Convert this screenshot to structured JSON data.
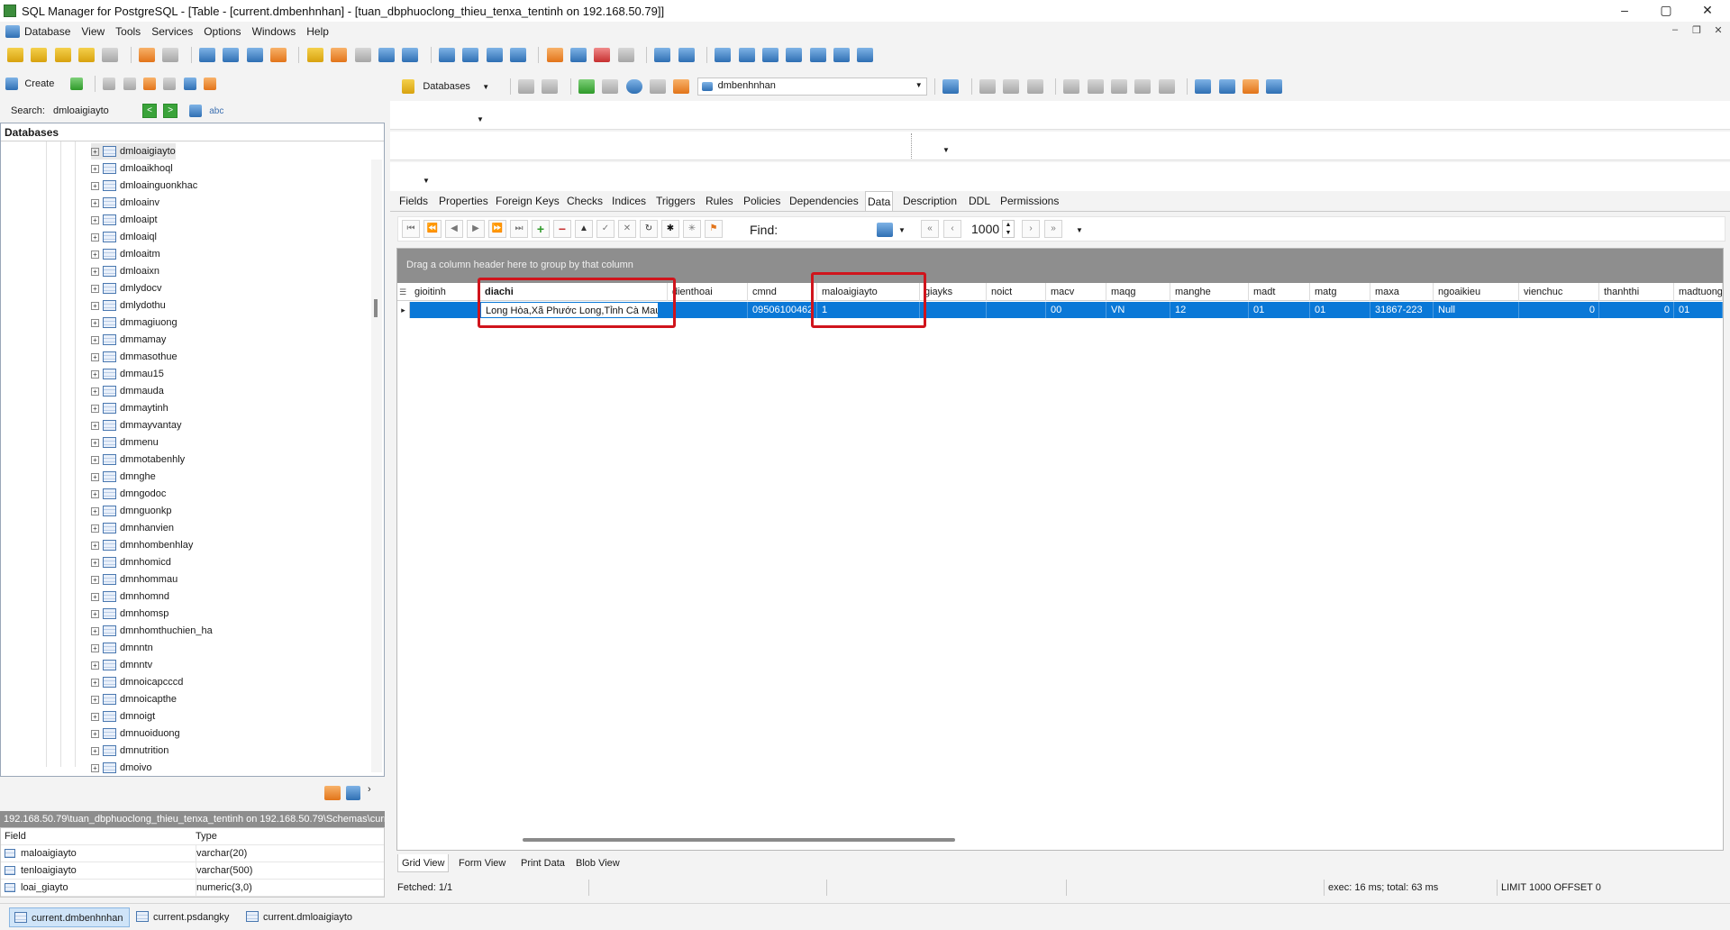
{
  "window": {
    "title": "SQL Manager for PostgreSQL - [Table - [current.dmbenhnhan] - [tuan_dbphuoclong_thieu_tenxa_tentinh on 192.168.50.79]]",
    "min": "–",
    "max": "▢",
    "close": "✕"
  },
  "menu": [
    "Database",
    "View",
    "Tools",
    "Services",
    "Options",
    "Windows",
    "Help"
  ],
  "left_toolbar": {
    "create_label": "Create"
  },
  "search": {
    "label": "Search:",
    "value": "dmloaigiayto",
    "prev": "<",
    "next": ">",
    "abc": "abc"
  },
  "explorer": {
    "header": "Databases",
    "items": [
      "dmloaigiayto",
      "dmloaikhoql",
      "dmloainguonkhac",
      "dmloainv",
      "dmloaipt",
      "dmloaiql",
      "dmloaitm",
      "dmloaixn",
      "dmlydocv",
      "dmlydothu",
      "dmmagiuong",
      "dmmamay",
      "dmmasothue",
      "dmmau15",
      "dmmauda",
      "dmmaytinh",
      "dmmayvantay",
      "dmmenu",
      "dmmotabenhly",
      "dmnghe",
      "dmngodoc",
      "dmnguonkp",
      "dmnhanvien",
      "dmnhombenhlay",
      "dmnhomicd",
      "dmnhommau",
      "dmnhomnd",
      "dmnhomsp",
      "dmnhomthuchien_ha",
      "dmnntn",
      "dmnntv",
      "dmnoicapcccd",
      "dmnoicapthe",
      "dmnoigt",
      "dmnuoiduong",
      "dmnutrition",
      "dmoivo"
    ]
  },
  "path_bar": "192.168.50.79\\tuan_dbphuoclong_thieu_tenxa_tentinh on 192.168.50.79\\Schemas\\curr",
  "field_grid": {
    "headers": [
      "Field",
      "Type"
    ],
    "rows": [
      {
        "field": "maloaigiayto",
        "type": "varchar(20)"
      },
      {
        "field": "tenloaigiayto",
        "type": "varchar(500)"
      },
      {
        "field": "loai_giayto",
        "type": "numeric(3,0)"
      }
    ]
  },
  "right_toolbar": {
    "databases_label": "Databases",
    "combo_value": "dmbenhnhan"
  },
  "tabs": [
    "Fields",
    "Properties",
    "Foreign Keys",
    "Checks",
    "Indices",
    "Triggers",
    "Rules",
    "Policies",
    "Dependencies",
    "Data",
    "Description",
    "DDL",
    "Permissions"
  ],
  "active_tab": "Data",
  "data_nav": {
    "find_label": "Find:",
    "limit": "1000"
  },
  "grid": {
    "group_hint": "Drag a column header here to group by that column",
    "columns": [
      "gioitinh",
      "diachi",
      "dienthoai",
      "cmnd",
      "maloaigiayto",
      "giayks",
      "noict",
      "macv",
      "maqg",
      "manghe",
      "madt",
      "matg",
      "maxa",
      "ngoaikieu",
      "vienchuc",
      "thanhthi",
      "madtuong"
    ],
    "row": [
      "",
      "Long Hòa,Xã Phước Long,Tỉnh Cà Mau",
      "",
      "09506100462",
      "1",
      "",
      "",
      "00",
      "VN",
      "12",
      "01",
      "01",
      "31867-223",
      "Null",
      "0",
      "0",
      "01"
    ]
  },
  "view_tabs": [
    "Grid View",
    "Form View",
    "Print Data",
    "Blob View"
  ],
  "status": {
    "fetched": "Fetched: 1/1",
    "exec": "exec: 16 ms; total: 63 ms",
    "limit": "LIMIT 1000 OFFSET 0"
  },
  "window_tabs": [
    "current.dmbenhnhan",
    "current.psdangky",
    "current.dmloaigiayto"
  ]
}
